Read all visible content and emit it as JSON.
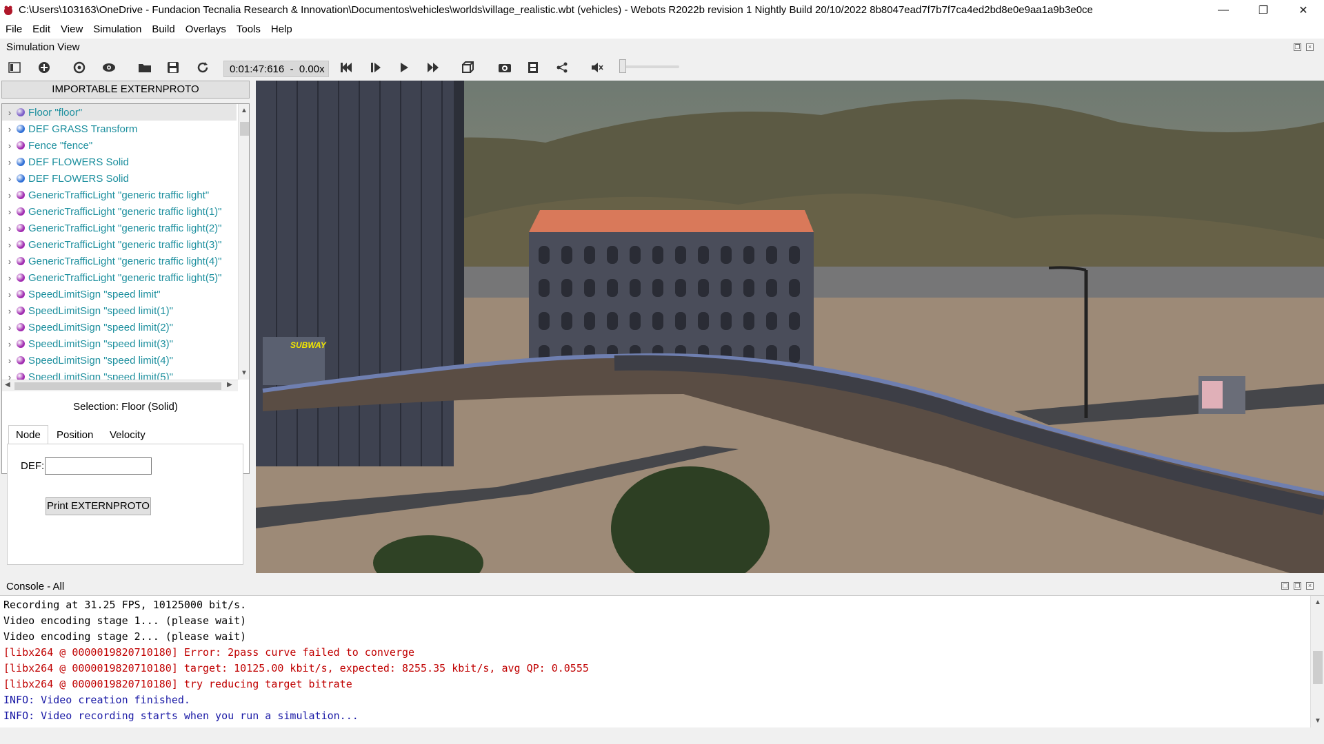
{
  "window": {
    "title": "C:\\Users\\103163\\OneDrive - Fundacion Tecnalia Research & Innovation\\Documentos\\vehicles\\worlds\\village_realistic.wbt (vehicles) - Webots R2022b revision 1 Nightly Build 20/10/2022 8b8047ead7f7b7f7ca4ed2bd8e0e9aa1a9b3e0ce",
    "minimize": "—",
    "restore": "❐",
    "close": "✕"
  },
  "menu": [
    "File",
    "Edit",
    "View",
    "Simulation",
    "Build",
    "Overlays",
    "Tools",
    "Help"
  ],
  "simulation_view": {
    "label": "Simulation View"
  },
  "toolbar": {
    "time": "0:01:47:616",
    "speed": "0.00x",
    "time_display": "0:01:47:616  -  0.00x"
  },
  "scene_tree": {
    "importable_button": "IMPORTABLE EXTERNPROTO",
    "items": [
      {
        "label": "Floor \"floor\"",
        "dot": "#7a5cc8",
        "selected": true
      },
      {
        "label": "DEF GRASS Transform",
        "dot": "#2f6fd6"
      },
      {
        "label": "Fence \"fence\"",
        "dot": "#a02ab0"
      },
      {
        "label": "DEF FLOWERS Solid",
        "dot": "#2f6fd6"
      },
      {
        "label": "DEF FLOWERS Solid",
        "dot": "#2f6fd6"
      },
      {
        "label": "GenericTrafficLight \"generic traffic light\"",
        "dot": "#a02ab0"
      },
      {
        "label": "GenericTrafficLight \"generic traffic light(1)\"",
        "dot": "#a02ab0"
      },
      {
        "label": "GenericTrafficLight \"generic traffic light(2)\"",
        "dot": "#a02ab0"
      },
      {
        "label": "GenericTrafficLight \"generic traffic light(3)\"",
        "dot": "#a02ab0"
      },
      {
        "label": "GenericTrafficLight \"generic traffic light(4)\"",
        "dot": "#a02ab0"
      },
      {
        "label": "GenericTrafficLight \"generic traffic light(5)\"",
        "dot": "#a02ab0"
      },
      {
        "label": "SpeedLimitSign \"speed limit\"",
        "dot": "#a02ab0"
      },
      {
        "label": "SpeedLimitSign \"speed limit(1)\"",
        "dot": "#a02ab0"
      },
      {
        "label": "SpeedLimitSign \"speed limit(2)\"",
        "dot": "#a02ab0"
      },
      {
        "label": "SpeedLimitSign \"speed limit(3)\"",
        "dot": "#a02ab0"
      },
      {
        "label": "SpeedLimitSign \"speed limit(4)\"",
        "dot": "#a02ab0"
      },
      {
        "label": "SpeedLimitSign \"speed limit(5)\"",
        "dot": "#a02ab0"
      }
    ]
  },
  "field_editor": {
    "selection": "Selection: Floor (Solid)",
    "tabs": [
      "Node",
      "Position",
      "Velocity"
    ],
    "active_tab": "Node",
    "def_label": "DEF:",
    "def_value": "",
    "print_button": "Print EXTERNPROTO"
  },
  "console": {
    "label": "Console - All",
    "lines": [
      {
        "text": "Recording at 31.25 FPS, 10125000 bit/s.",
        "color": "#000000"
      },
      {
        "text": "Video encoding stage 1... (please wait)",
        "color": "#000000"
      },
      {
        "text": "Video encoding stage 2... (please wait)",
        "color": "#000000"
      },
      {
        "text": "[libx264 @ 0000019820710180] Error: 2pass curve failed to converge",
        "color": "#c00000"
      },
      {
        "text": "[libx264 @ 0000019820710180] target: 10125.00 kbit/s, expected: 8255.35 kbit/s, avg QP: 0.0555",
        "color": "#c00000"
      },
      {
        "text": "[libx264 @ 0000019820710180] try reducing target bitrate",
        "color": "#c00000"
      },
      {
        "text": "INFO: Video creation finished.",
        "color": "#1a1aa6"
      },
      {
        "text": "INFO: Video recording starts when you run a simulation...",
        "color": "#1a1aa6"
      }
    ]
  },
  "scene": {
    "sign_text": "SUBWAY"
  }
}
